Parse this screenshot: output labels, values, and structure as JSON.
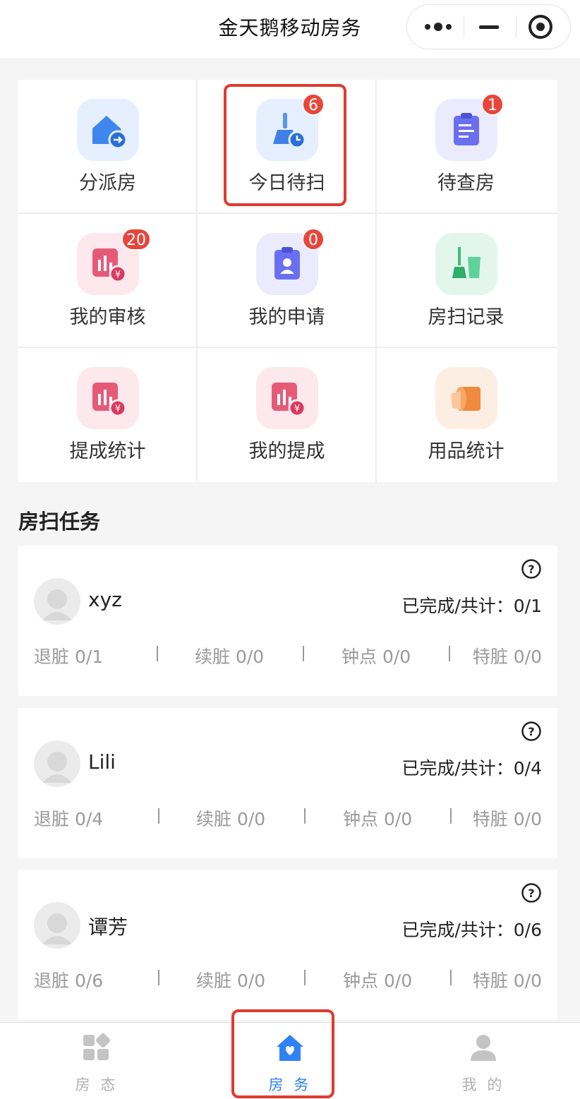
{
  "nav": {
    "title": "金天鹅移动房务"
  },
  "colors": {
    "accent_blue": "#2f82f6",
    "badge_red": "#e8463b",
    "highlight_red": "#e13a2f",
    "inactive_gray": "#b0b0b0"
  },
  "grid": [
    {
      "label": "分派房",
      "icon": "house-arrow-icon",
      "badge": null
    },
    {
      "label": "今日待扫",
      "icon": "broom-clock-icon",
      "badge": "6",
      "highlighted": true
    },
    {
      "label": "待查房",
      "icon": "clipboard-icon",
      "badge": "1"
    },
    {
      "label": "我的审核",
      "icon": "chart-yen-icon",
      "badge": "20"
    },
    {
      "label": "我的申请",
      "icon": "id-card-icon",
      "badge": "0"
    },
    {
      "label": "房扫记录",
      "icon": "broom-bag-icon",
      "badge": null
    },
    {
      "label": "提成统计",
      "icon": "chart-yen-icon",
      "badge": null
    },
    {
      "label": "我的提成",
      "icon": "chart-yen-icon",
      "badge": null
    },
    {
      "label": "用品统计",
      "icon": "paper-roll-icon",
      "badge": null
    }
  ],
  "section_title": "房扫任务",
  "tasks": [
    {
      "name": "xyz",
      "progress": "已完成/共计：0/1",
      "checkout": "退脏 0/1",
      "stay": "续脏 0/0",
      "hourly": "钟点 0/0",
      "special": "特脏 0/0"
    },
    {
      "name": "Lili",
      "progress": "已完成/共计：0/4",
      "checkout": "退脏 0/4",
      "stay": "续脏 0/0",
      "hourly": "钟点 0/0",
      "special": "特脏 0/0"
    },
    {
      "name": "谭芳",
      "progress": "已完成/共计：0/6",
      "checkout": "退脏 0/6",
      "stay": "续脏 0/0",
      "hourly": "钟点 0/0",
      "special": "特脏 0/0"
    }
  ],
  "tabbar": [
    {
      "label": "房 态",
      "icon": "grid-shapes-icon",
      "active": false
    },
    {
      "label": "房 务",
      "icon": "home-heart-icon",
      "active": true
    },
    {
      "label": "我 的",
      "icon": "user-icon",
      "active": false
    }
  ]
}
